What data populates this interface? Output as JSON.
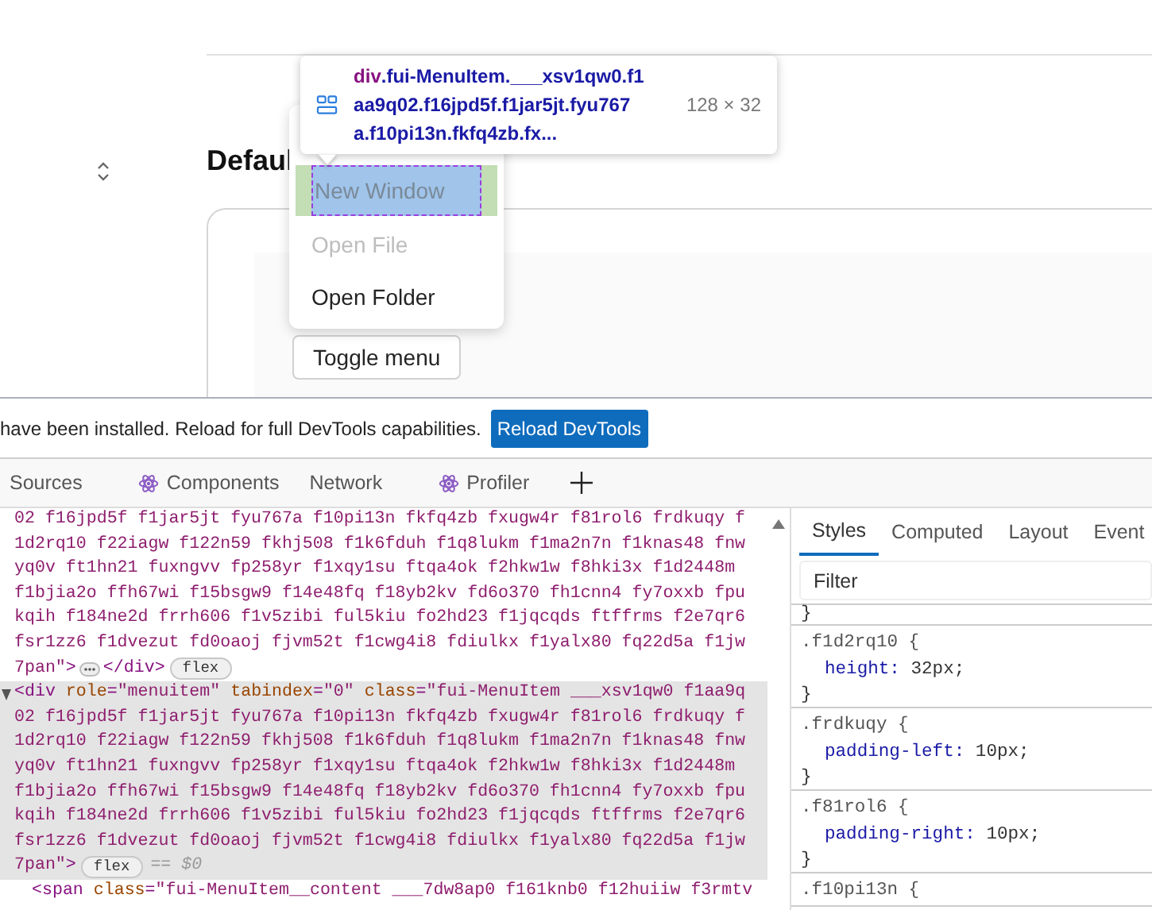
{
  "page": {
    "heading": "Defaul",
    "toggle_button": "Toggle menu",
    "menu": [
      {
        "label": "New Window",
        "disabled": false,
        "inspected": true
      },
      {
        "label": "Open File",
        "disabled": true,
        "inspected": false
      },
      {
        "label": "Open Folder",
        "disabled": false,
        "inspected": false
      }
    ],
    "tooltip": {
      "tag": "div",
      "selector_lines": [
        ".fui-MenuItem.___xsv1qw0.f1",
        "aa9q02.f16jpd5f.f1jar5jt.fyu767",
        "a.f10pi13n.fkfq4zb.fx..."
      ],
      "size": "128 × 32"
    }
  },
  "infobar": {
    "message": "have been installed. Reload for full DevTools capabilities.",
    "button": "Reload DevTools"
  },
  "devtools_tabs": [
    {
      "label": "Sources",
      "kind": "plain",
      "selected": false
    },
    {
      "label": "Components",
      "kind": "react",
      "selected": false
    },
    {
      "label": "Network",
      "kind": "plain",
      "selected": false
    },
    {
      "label": "Profiler",
      "kind": "react",
      "selected": false
    }
  ],
  "elements": [
    {
      "selected": false,
      "segments": [
        {
          "kind": "value",
          "text": "02 f16jpd5f f1jar5jt fyu767a f10pi13n fkfq4zb fxugw4r f81rol6 frdkuqy f"
        }
      ]
    },
    {
      "selected": false,
      "segments": [
        {
          "kind": "value",
          "text": "1d2rq10 f22iagw f122n59 fkhj508 f1k6fduh f1q8lukm f1ma2n7n f1knas48 fnw"
        }
      ]
    },
    {
      "selected": false,
      "segments": [
        {
          "kind": "value",
          "text": "yq0v ft1hn21 fuxngvv fp258yr f1xqy1su ftqa4ok f2hkw1w f8hki3x f1d2448m"
        }
      ]
    },
    {
      "selected": false,
      "segments": [
        {
          "kind": "value",
          "text": "f1bjia2o ffh67wi f15bsgw9 f14e48fq f18yb2kv fd6o370 fh1cnn4 fy7oxxb fpu"
        }
      ]
    },
    {
      "selected": false,
      "segments": [
        {
          "kind": "value",
          "text": "kqih f184ne2d frrh606 f1v5zibi ful5kiu fo2hd23 f1jqcqds ftffrms f2e7qr6"
        }
      ]
    },
    {
      "selected": false,
      "segments": [
        {
          "kind": "value",
          "text": "fsr1zz6 f1dvezut fd0oaoj fjvm52t f1cwg4i8 fdiulkx f1yalx80 fq22d5a f1jw"
        }
      ]
    },
    {
      "selected": false,
      "segments": [
        {
          "kind": "value",
          "text": "7pan\""
        },
        {
          "kind": "punct",
          "text": ">"
        },
        {
          "kind": "ellipsis"
        },
        {
          "kind": "punct",
          "text": "</"
        },
        {
          "kind": "tag",
          "text": "div"
        },
        {
          "kind": "punct",
          "text": ">"
        },
        {
          "kind": "badge",
          "text": "flex"
        }
      ]
    },
    {
      "selected": true,
      "expander": true,
      "segments": [
        {
          "kind": "punct",
          "text": "<"
        },
        {
          "kind": "tag",
          "text": "div"
        },
        {
          "kind": "attr",
          "text": " role"
        },
        {
          "kind": "punct",
          "text": "="
        },
        {
          "kind": "value",
          "text": "\"menuitem\""
        },
        {
          "kind": "attr",
          "text": " tabindex"
        },
        {
          "kind": "punct",
          "text": "="
        },
        {
          "kind": "value",
          "text": "\"0\""
        },
        {
          "kind": "attr",
          "text": " class"
        },
        {
          "kind": "punct",
          "text": "="
        },
        {
          "kind": "value",
          "text": "\"fui-MenuItem ___xsv1qw0 f1aa9q"
        }
      ]
    },
    {
      "selected": true,
      "segments": [
        {
          "kind": "value",
          "text": "02 f16jpd5f f1jar5jt fyu767a f10pi13n fkfq4zb fxugw4r f81rol6 frdkuqy f"
        }
      ]
    },
    {
      "selected": true,
      "segments": [
        {
          "kind": "value",
          "text": "1d2rq10 f22iagw f122n59 fkhj508 f1k6fduh f1q8lukm f1ma2n7n f1knas48 fnw"
        }
      ]
    },
    {
      "selected": true,
      "segments": [
        {
          "kind": "value",
          "text": "yq0v ft1hn21 fuxngvv fp258yr f1xqy1su ftqa4ok f2hkw1w f8hki3x f1d2448m"
        }
      ]
    },
    {
      "selected": true,
      "segments": [
        {
          "kind": "value",
          "text": "f1bjia2o ffh67wi f15bsgw9 f14e48fq f18yb2kv fd6o370 fh1cnn4 fy7oxxb fpu"
        }
      ]
    },
    {
      "selected": true,
      "segments": [
        {
          "kind": "value",
          "text": "kqih f184ne2d frrh606 f1v5zibi ful5kiu fo2hd23 f1jqcqds ftffrms f2e7qr6"
        }
      ]
    },
    {
      "selected": true,
      "segments": [
        {
          "kind": "value",
          "text": "fsr1zz6 f1dvezut fd0oaoj fjvm52t f1cwg4i8 fdiulkx f1yalx80 fq22d5a f1jw"
        }
      ]
    },
    {
      "selected": true,
      "segments": [
        {
          "kind": "value",
          "text": "7pan\""
        },
        {
          "kind": "punct",
          "text": ">"
        },
        {
          "kind": "badge",
          "text": "flex"
        },
        {
          "kind": "muted",
          "text": "== $0"
        }
      ]
    },
    {
      "selected": false,
      "child": true,
      "segments": [
        {
          "kind": "punct",
          "text": "<"
        },
        {
          "kind": "tag",
          "text": "span"
        },
        {
          "kind": "attr",
          "text": " class"
        },
        {
          "kind": "punct",
          "text": "="
        },
        {
          "kind": "value",
          "text": "\"fui-MenuItem__content ___7dw8ap0 f161knb0 f12huiiw f3rmtv"
        }
      ]
    }
  ],
  "styles": {
    "tabs": [
      {
        "label": "Styles",
        "selected": true
      },
      {
        "label": "Computed",
        "selected": false
      },
      {
        "label": "Layout",
        "selected": false
      },
      {
        "label": "Event",
        "selected": false
      }
    ],
    "filter": {
      "placeholder": "Filter"
    },
    "previous_rule_end": "}",
    "rules": [
      {
        "selector": ".f1d2rq10 {",
        "declarations": [
          {
            "property": "height:",
            "value": "32px;"
          }
        ],
        "close": "}"
      },
      {
        "selector": ".frdkuqy {",
        "declarations": [
          {
            "property": "padding-left:",
            "value": "10px;"
          }
        ],
        "close": "}"
      },
      {
        "selector": ".f81rol6 {",
        "declarations": [
          {
            "property": "padding-right:",
            "value": "10px;"
          }
        ],
        "close": "}"
      },
      {
        "selector": ".f10pi13n {"
      }
    ]
  }
}
